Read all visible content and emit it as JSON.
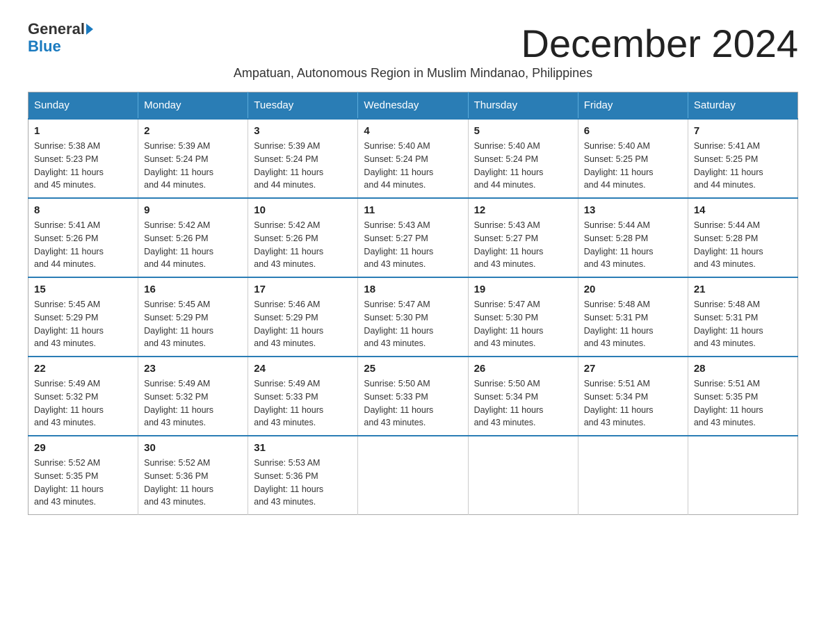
{
  "logo": {
    "line1": "General",
    "line2": "Blue"
  },
  "title": "December 2024",
  "subtitle": "Ampatuan, Autonomous Region in Muslim Mindanao, Philippines",
  "days_of_week": [
    "Sunday",
    "Monday",
    "Tuesday",
    "Wednesday",
    "Thursday",
    "Friday",
    "Saturday"
  ],
  "weeks": [
    [
      {
        "day": "1",
        "sunrise": "5:38 AM",
        "sunset": "5:23 PM",
        "daylight": "11 hours and 45 minutes."
      },
      {
        "day": "2",
        "sunrise": "5:39 AM",
        "sunset": "5:24 PM",
        "daylight": "11 hours and 44 minutes."
      },
      {
        "day": "3",
        "sunrise": "5:39 AM",
        "sunset": "5:24 PM",
        "daylight": "11 hours and 44 minutes."
      },
      {
        "day": "4",
        "sunrise": "5:40 AM",
        "sunset": "5:24 PM",
        "daylight": "11 hours and 44 minutes."
      },
      {
        "day": "5",
        "sunrise": "5:40 AM",
        "sunset": "5:24 PM",
        "daylight": "11 hours and 44 minutes."
      },
      {
        "day": "6",
        "sunrise": "5:40 AM",
        "sunset": "5:25 PM",
        "daylight": "11 hours and 44 minutes."
      },
      {
        "day": "7",
        "sunrise": "5:41 AM",
        "sunset": "5:25 PM",
        "daylight": "11 hours and 44 minutes."
      }
    ],
    [
      {
        "day": "8",
        "sunrise": "5:41 AM",
        "sunset": "5:26 PM",
        "daylight": "11 hours and 44 minutes."
      },
      {
        "day": "9",
        "sunrise": "5:42 AM",
        "sunset": "5:26 PM",
        "daylight": "11 hours and 44 minutes."
      },
      {
        "day": "10",
        "sunrise": "5:42 AM",
        "sunset": "5:26 PM",
        "daylight": "11 hours and 43 minutes."
      },
      {
        "day": "11",
        "sunrise": "5:43 AM",
        "sunset": "5:27 PM",
        "daylight": "11 hours and 43 minutes."
      },
      {
        "day": "12",
        "sunrise": "5:43 AM",
        "sunset": "5:27 PM",
        "daylight": "11 hours and 43 minutes."
      },
      {
        "day": "13",
        "sunrise": "5:44 AM",
        "sunset": "5:28 PM",
        "daylight": "11 hours and 43 minutes."
      },
      {
        "day": "14",
        "sunrise": "5:44 AM",
        "sunset": "5:28 PM",
        "daylight": "11 hours and 43 minutes."
      }
    ],
    [
      {
        "day": "15",
        "sunrise": "5:45 AM",
        "sunset": "5:29 PM",
        "daylight": "11 hours and 43 minutes."
      },
      {
        "day": "16",
        "sunrise": "5:45 AM",
        "sunset": "5:29 PM",
        "daylight": "11 hours and 43 minutes."
      },
      {
        "day": "17",
        "sunrise": "5:46 AM",
        "sunset": "5:29 PM",
        "daylight": "11 hours and 43 minutes."
      },
      {
        "day": "18",
        "sunrise": "5:47 AM",
        "sunset": "5:30 PM",
        "daylight": "11 hours and 43 minutes."
      },
      {
        "day": "19",
        "sunrise": "5:47 AM",
        "sunset": "5:30 PM",
        "daylight": "11 hours and 43 minutes."
      },
      {
        "day": "20",
        "sunrise": "5:48 AM",
        "sunset": "5:31 PM",
        "daylight": "11 hours and 43 minutes."
      },
      {
        "day": "21",
        "sunrise": "5:48 AM",
        "sunset": "5:31 PM",
        "daylight": "11 hours and 43 minutes."
      }
    ],
    [
      {
        "day": "22",
        "sunrise": "5:49 AM",
        "sunset": "5:32 PM",
        "daylight": "11 hours and 43 minutes."
      },
      {
        "day": "23",
        "sunrise": "5:49 AM",
        "sunset": "5:32 PM",
        "daylight": "11 hours and 43 minutes."
      },
      {
        "day": "24",
        "sunrise": "5:49 AM",
        "sunset": "5:33 PM",
        "daylight": "11 hours and 43 minutes."
      },
      {
        "day": "25",
        "sunrise": "5:50 AM",
        "sunset": "5:33 PM",
        "daylight": "11 hours and 43 minutes."
      },
      {
        "day": "26",
        "sunrise": "5:50 AM",
        "sunset": "5:34 PM",
        "daylight": "11 hours and 43 minutes."
      },
      {
        "day": "27",
        "sunrise": "5:51 AM",
        "sunset": "5:34 PM",
        "daylight": "11 hours and 43 minutes."
      },
      {
        "day": "28",
        "sunrise": "5:51 AM",
        "sunset": "5:35 PM",
        "daylight": "11 hours and 43 minutes."
      }
    ],
    [
      {
        "day": "29",
        "sunrise": "5:52 AM",
        "sunset": "5:35 PM",
        "daylight": "11 hours and 43 minutes."
      },
      {
        "day": "30",
        "sunrise": "5:52 AM",
        "sunset": "5:36 PM",
        "daylight": "11 hours and 43 minutes."
      },
      {
        "day": "31",
        "sunrise": "5:53 AM",
        "sunset": "5:36 PM",
        "daylight": "11 hours and 43 minutes."
      },
      null,
      null,
      null,
      null
    ]
  ],
  "labels": {
    "sunrise": "Sunrise:",
    "sunset": "Sunset:",
    "daylight": "Daylight:"
  }
}
